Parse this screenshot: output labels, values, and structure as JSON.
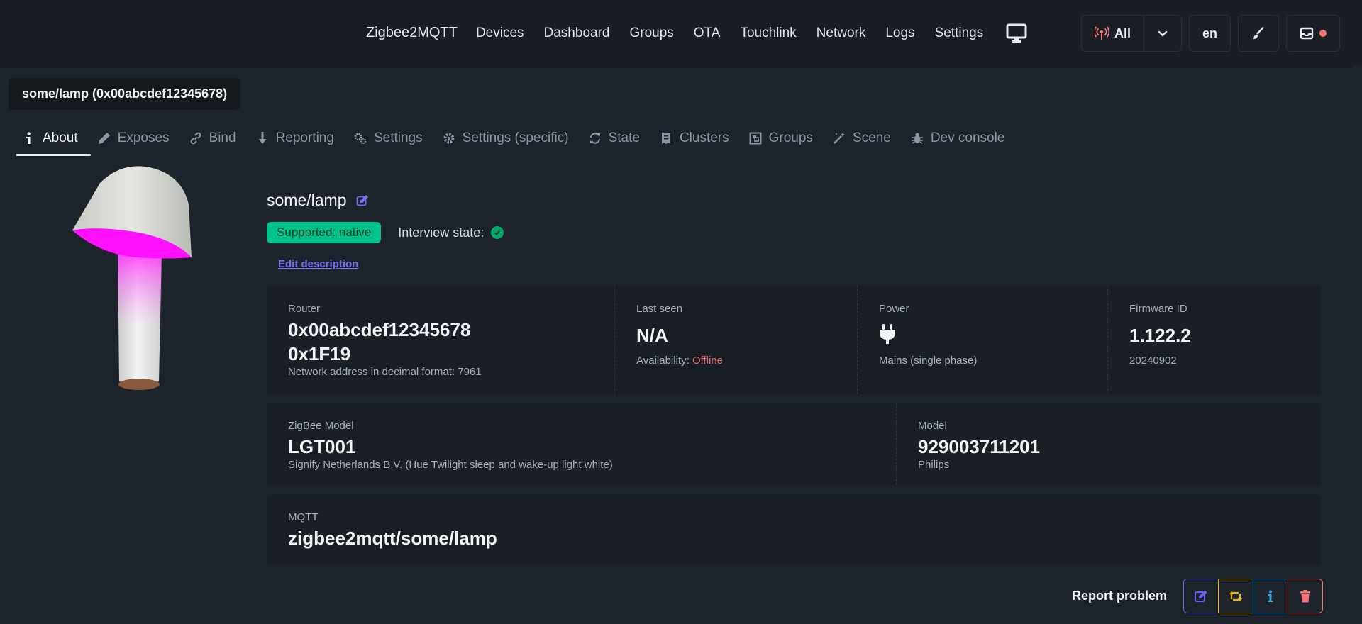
{
  "app": {
    "brand": "Zigbee2MQTT",
    "nav": [
      "Devices",
      "Dashboard",
      "Groups",
      "OTA",
      "Touchlink",
      "Network",
      "Logs",
      "Settings"
    ],
    "right": {
      "filter_label": "All",
      "language": "en"
    }
  },
  "device": {
    "title": "some/lamp (0x00abcdef12345678)",
    "name": "some/lamp",
    "supported_badge": "Supported: native",
    "interview_label": "Interview state:",
    "edit_description": "Edit description"
  },
  "tabs": [
    {
      "label": "About",
      "icon": "info-icon",
      "active": true
    },
    {
      "label": "Exposes",
      "icon": "pen-icon"
    },
    {
      "label": "Bind",
      "icon": "link-icon"
    },
    {
      "label": "Reporting",
      "icon": "download-icon"
    },
    {
      "label": "Settings",
      "icon": "gears-icon"
    },
    {
      "label": "Settings (specific)",
      "icon": "gear-icon"
    },
    {
      "label": "State",
      "icon": "rotate-icon"
    },
    {
      "label": "Clusters",
      "icon": "receipt-icon"
    },
    {
      "label": "Groups",
      "icon": "object-group-icon"
    },
    {
      "label": "Scene",
      "icon": "wand-icon"
    },
    {
      "label": "Dev console",
      "icon": "bug-icon"
    }
  ],
  "stats_row1": {
    "router": {
      "title": "Router",
      "value1": "0x00abcdef12345678",
      "value2": "0x1F19",
      "desc": "Network address in decimal format: 7961"
    },
    "last_seen": {
      "title": "Last seen",
      "value": "N/A",
      "desc_label": "Availability:",
      "desc_value": "Offline"
    },
    "power": {
      "title": "Power",
      "desc": "Mains (single phase)"
    },
    "firmware": {
      "title": "Firmware ID",
      "value": "1.122.2",
      "desc": "20240902"
    }
  },
  "stats_row2": {
    "zigbee_model": {
      "title": "ZigBee Model",
      "value": "LGT001",
      "desc": "Signify Netherlands B.V. (Hue Twilight sleep and wake-up light white)"
    },
    "model": {
      "title": "Model",
      "value": "929003711201",
      "desc": "Philips"
    }
  },
  "stats_row3": {
    "mqtt": {
      "title": "MQTT",
      "value": "zigbee2mqtt/some/lamp"
    }
  },
  "footer": {
    "report_problem": "Report problem"
  },
  "colors": {
    "accent_green": "#00c38a",
    "link_purple": "#7b6cf6",
    "offline_red": "#e06b6b",
    "action_purple": "#6d5cf5",
    "action_yellow": "#f2b705",
    "action_blue": "#2aa8e8",
    "action_red": "#f87272"
  }
}
